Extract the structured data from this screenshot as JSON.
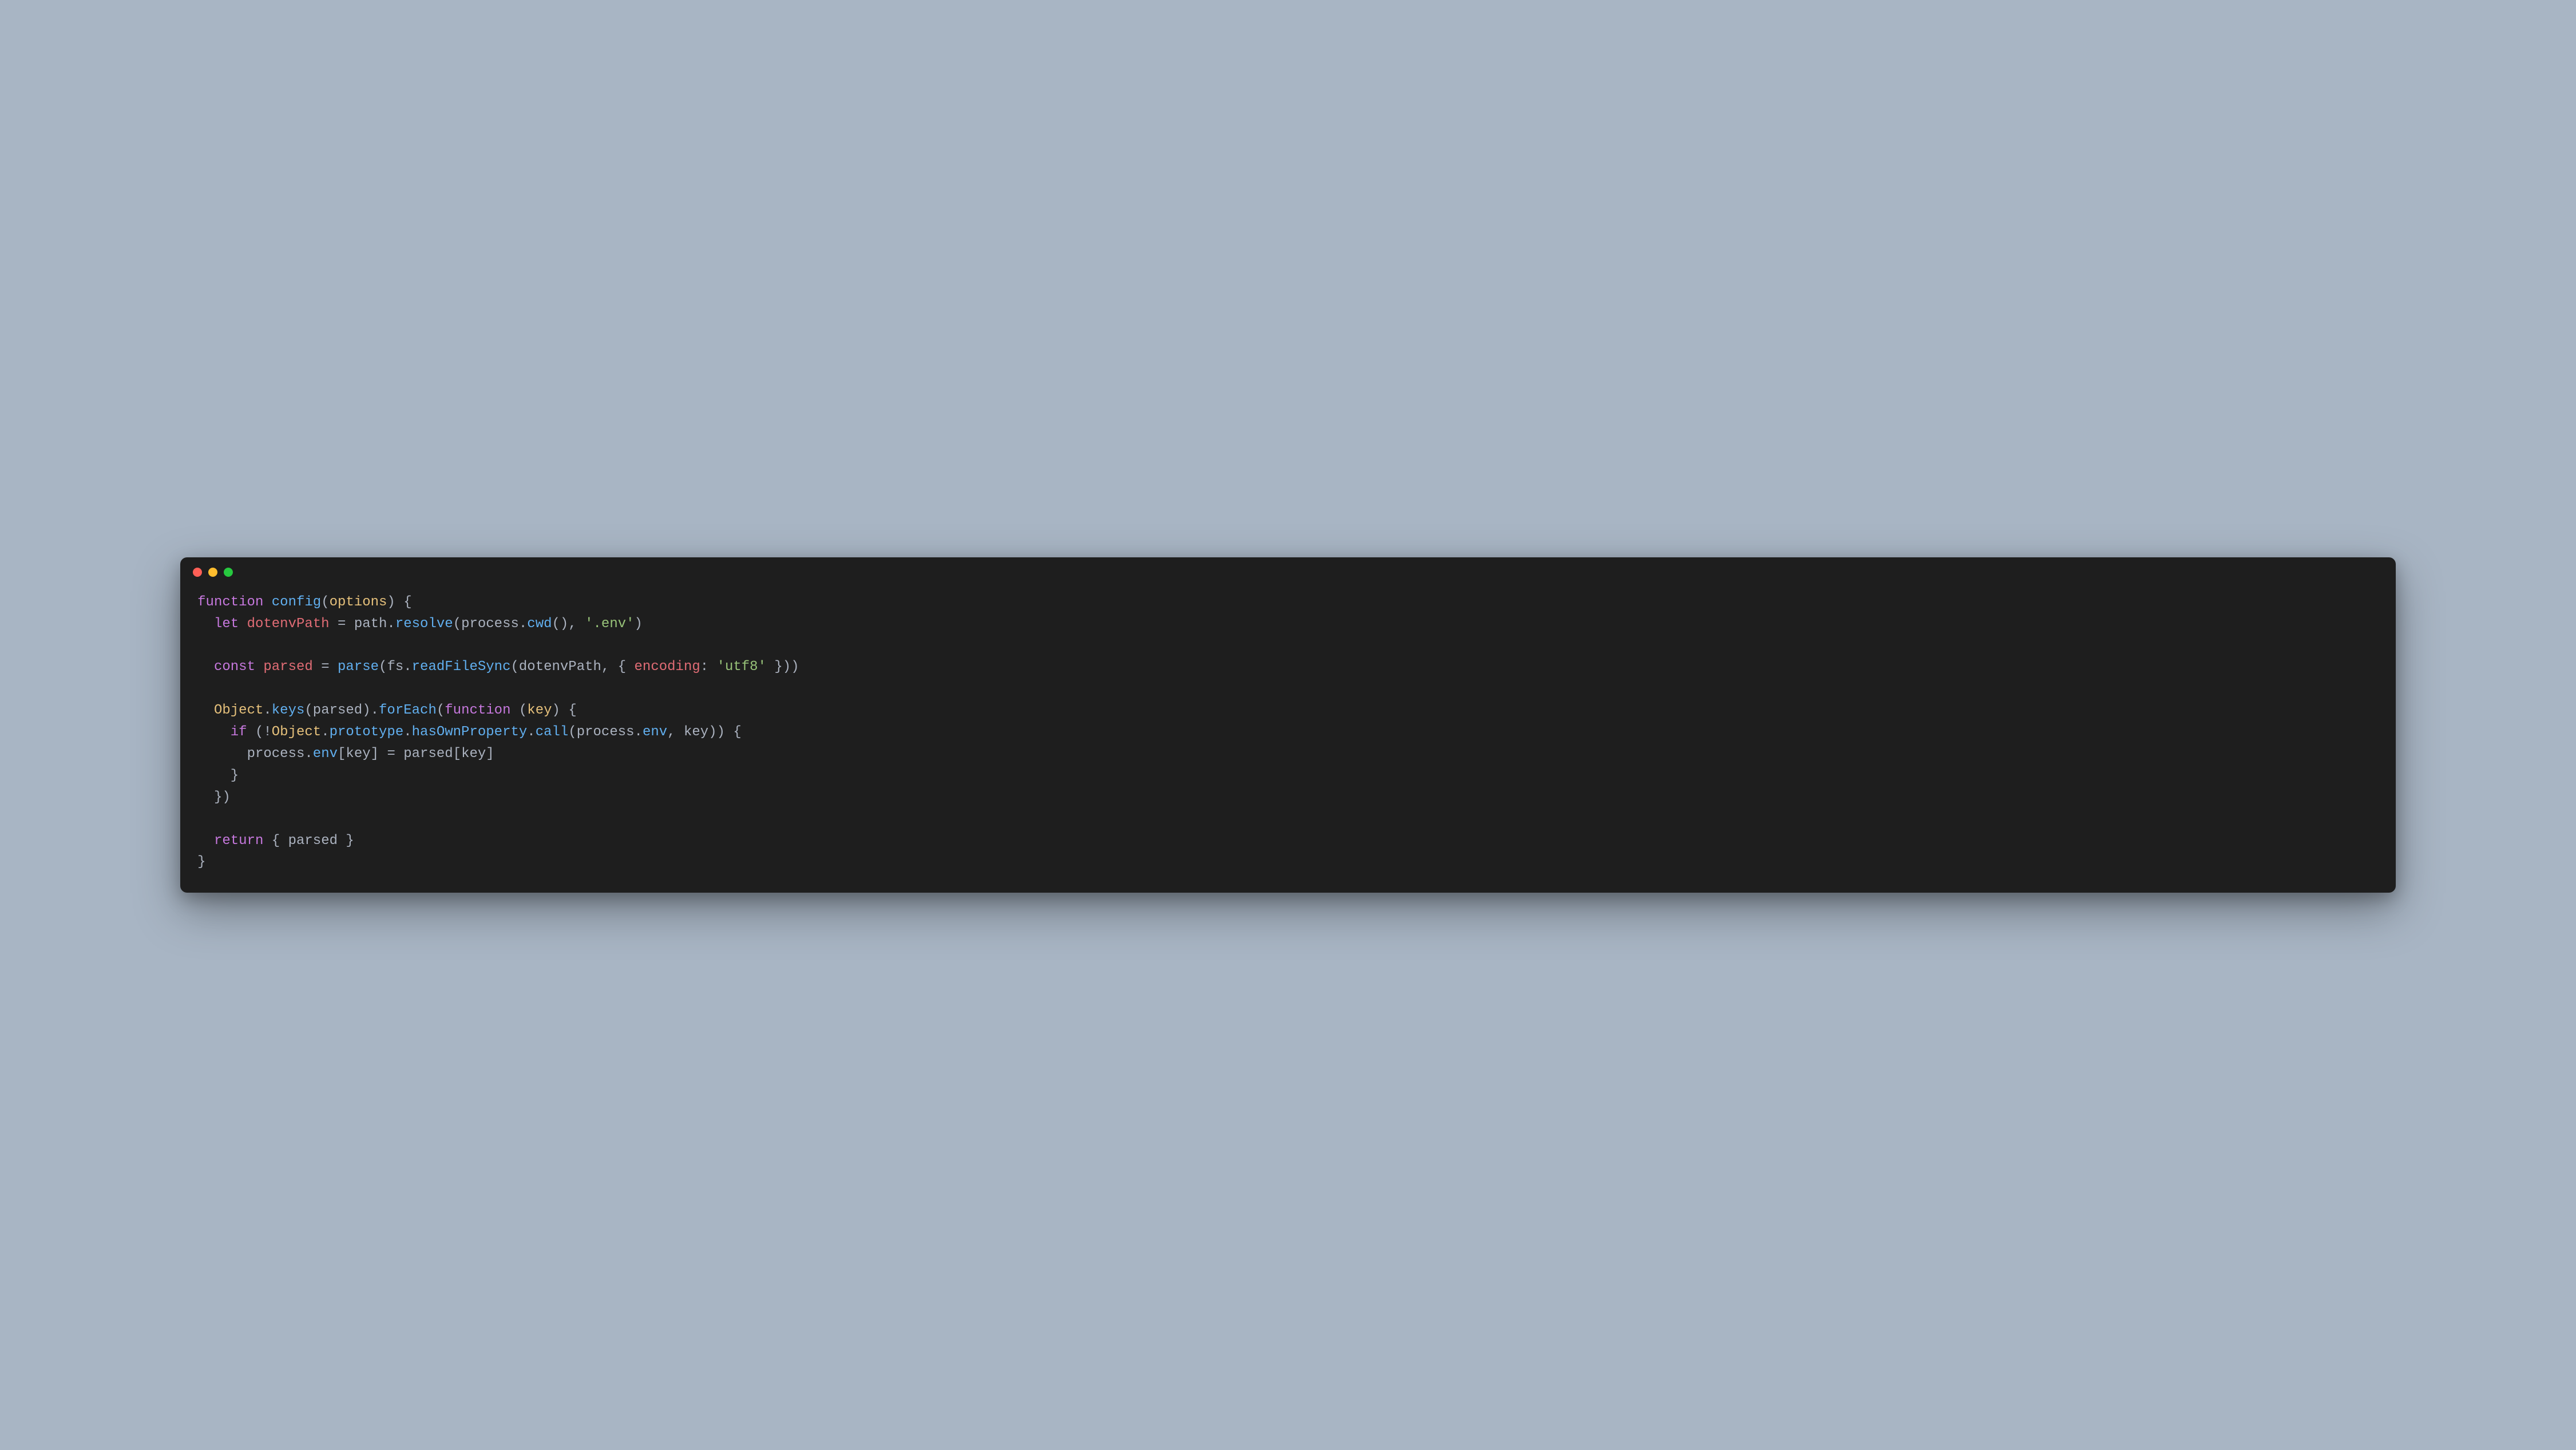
{
  "colors": {
    "bg_page": "#a8b5c4",
    "bg_window": "#1e1e1e",
    "dot_red": "#ff5f56",
    "dot_yellow": "#ffbd2e",
    "dot_green": "#27c93f",
    "keyword": "#c678dd",
    "function": "#61afef",
    "param": "#e5c07b",
    "variable": "#e06c75",
    "string": "#98c379",
    "punct": "#abb2bf",
    "object": "#e5c07b"
  },
  "code": {
    "lines": [
      [
        {
          "t": "function ",
          "c": "keyword"
        },
        {
          "t": "config",
          "c": "function"
        },
        {
          "t": "(",
          "c": "punct"
        },
        {
          "t": "options",
          "c": "param"
        },
        {
          "t": ") {",
          "c": "punct"
        }
      ],
      [
        {
          "t": "  ",
          "c": "plain"
        },
        {
          "t": "let ",
          "c": "keyword"
        },
        {
          "t": "dotenvPath",
          "c": "variable"
        },
        {
          "t": " = ",
          "c": "punct"
        },
        {
          "t": "path",
          "c": "plain"
        },
        {
          "t": ".",
          "c": "punct"
        },
        {
          "t": "resolve",
          "c": "function"
        },
        {
          "t": "(",
          "c": "punct"
        },
        {
          "t": "process",
          "c": "plain"
        },
        {
          "t": ".",
          "c": "punct"
        },
        {
          "t": "cwd",
          "c": "function"
        },
        {
          "t": "(), ",
          "c": "punct"
        },
        {
          "t": "'.env'",
          "c": "string"
        },
        {
          "t": ")",
          "c": "punct"
        }
      ],
      [],
      [
        {
          "t": "  ",
          "c": "plain"
        },
        {
          "t": "const ",
          "c": "keyword"
        },
        {
          "t": "parsed",
          "c": "variable"
        },
        {
          "t": " = ",
          "c": "punct"
        },
        {
          "t": "parse",
          "c": "function"
        },
        {
          "t": "(",
          "c": "punct"
        },
        {
          "t": "fs",
          "c": "plain"
        },
        {
          "t": ".",
          "c": "punct"
        },
        {
          "t": "readFileSync",
          "c": "function"
        },
        {
          "t": "(",
          "c": "punct"
        },
        {
          "t": "dotenvPath",
          "c": "plain"
        },
        {
          "t": ", { ",
          "c": "punct"
        },
        {
          "t": "encoding",
          "c": "variable"
        },
        {
          "t": ": ",
          "c": "punct"
        },
        {
          "t": "'utf8'",
          "c": "string"
        },
        {
          "t": " }))",
          "c": "punct"
        }
      ],
      [],
      [
        {
          "t": "  ",
          "c": "plain"
        },
        {
          "t": "Object",
          "c": "object"
        },
        {
          "t": ".",
          "c": "punct"
        },
        {
          "t": "keys",
          "c": "function"
        },
        {
          "t": "(",
          "c": "punct"
        },
        {
          "t": "parsed",
          "c": "plain"
        },
        {
          "t": ").",
          "c": "punct"
        },
        {
          "t": "forEach",
          "c": "function"
        },
        {
          "t": "(",
          "c": "punct"
        },
        {
          "t": "function ",
          "c": "keyword"
        },
        {
          "t": "(",
          "c": "punct"
        },
        {
          "t": "key",
          "c": "param"
        },
        {
          "t": ") {",
          "c": "punct"
        }
      ],
      [
        {
          "t": "    ",
          "c": "plain"
        },
        {
          "t": "if ",
          "c": "keyword"
        },
        {
          "t": "(!",
          "c": "punct"
        },
        {
          "t": "Object",
          "c": "object"
        },
        {
          "t": ".",
          "c": "punct"
        },
        {
          "t": "prototype",
          "c": "property"
        },
        {
          "t": ".",
          "c": "punct"
        },
        {
          "t": "hasOwnProperty",
          "c": "property"
        },
        {
          "t": ".",
          "c": "punct"
        },
        {
          "t": "call",
          "c": "function"
        },
        {
          "t": "(",
          "c": "punct"
        },
        {
          "t": "process",
          "c": "plain"
        },
        {
          "t": ".",
          "c": "punct"
        },
        {
          "t": "env",
          "c": "property"
        },
        {
          "t": ", ",
          "c": "punct"
        },
        {
          "t": "key",
          "c": "plain"
        },
        {
          "t": ")) {",
          "c": "punct"
        }
      ],
      [
        {
          "t": "      ",
          "c": "plain"
        },
        {
          "t": "process",
          "c": "plain"
        },
        {
          "t": ".",
          "c": "punct"
        },
        {
          "t": "env",
          "c": "property"
        },
        {
          "t": "[",
          "c": "punct"
        },
        {
          "t": "key",
          "c": "plain"
        },
        {
          "t": "] = ",
          "c": "punct"
        },
        {
          "t": "parsed",
          "c": "plain"
        },
        {
          "t": "[",
          "c": "punct"
        },
        {
          "t": "key",
          "c": "plain"
        },
        {
          "t": "]",
          "c": "punct"
        }
      ],
      [
        {
          "t": "    }",
          "c": "punct"
        }
      ],
      [
        {
          "t": "  })",
          "c": "punct"
        }
      ],
      [],
      [
        {
          "t": "  ",
          "c": "plain"
        },
        {
          "t": "return ",
          "c": "keyword"
        },
        {
          "t": "{ ",
          "c": "punct"
        },
        {
          "t": "parsed",
          "c": "plain"
        },
        {
          "t": " }",
          "c": "punct"
        }
      ],
      [
        {
          "t": "}",
          "c": "punct"
        }
      ]
    ]
  },
  "watermark": ""
}
